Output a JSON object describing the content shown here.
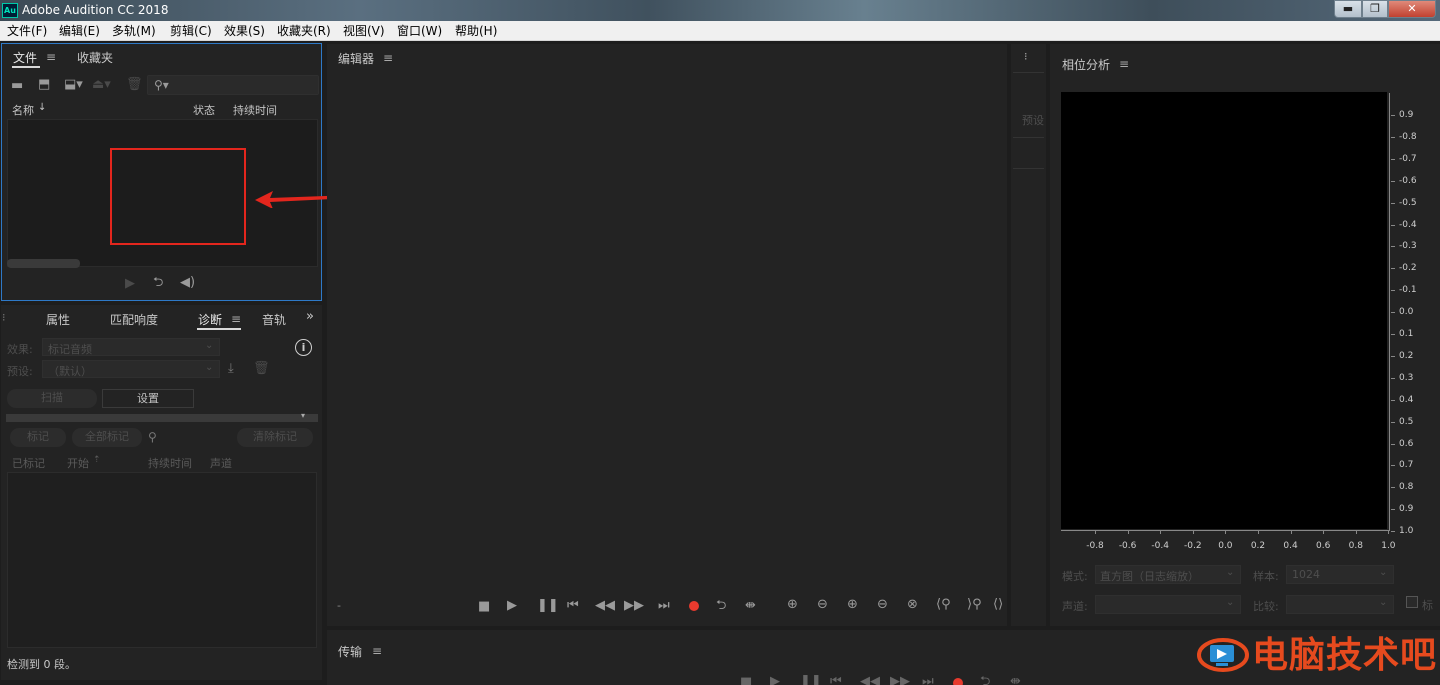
{
  "window": {
    "title": "Adobe Audition CC 2018",
    "logo_text": "Au",
    "controls": {
      "minimize": "▬",
      "maximize": "❐",
      "close": "✕"
    }
  },
  "menu": [
    "文件(F)",
    "编辑(E)",
    "多轨(M)",
    "剪辑(C)",
    "效果(S)",
    "收藏夹(R)",
    "视图(V)",
    "窗口(W)",
    "帮助(H)"
  ],
  "files_panel": {
    "tabs": [
      "文件",
      "收藏夹"
    ],
    "columns": {
      "name": "名称",
      "status": "状态",
      "duration": "持续时间"
    },
    "sort_arrow": "↓"
  },
  "diagnostics_panel": {
    "tabs": [
      "属性",
      "匹配响度",
      "诊断",
      "音轨"
    ],
    "effect_label": "效果:",
    "effect_value": "标记音频",
    "preset_label": "预设:",
    "preset_value": "（默认）",
    "scan_button": "扫描",
    "settings_button": "设置",
    "mark_button": "标记",
    "mark_all_button": "全部标记",
    "clear_marks_button": "清除标记",
    "columns": {
      "marked": "已标记",
      "start": "开始",
      "duration": "持续时间",
      "channel": "声道"
    },
    "status": "检测到 0 段。"
  },
  "editor": {
    "title": "编辑器",
    "time_text": "-"
  },
  "presets_strip": {
    "label": "预设"
  },
  "phase_analysis": {
    "title": "相位分析",
    "y_labels": [
      "0.9",
      "-0.8",
      "-0.7",
      "-0.6",
      "-0.5",
      "-0.4",
      "-0.3",
      "-0.2",
      "-0.1",
      "0.0",
      "0.1",
      "0.2",
      "0.3",
      "0.4",
      "0.5",
      "0.6",
      "0.7",
      "0.8",
      "0.9",
      "1.0"
    ],
    "x_labels": [
      "-0.8",
      "-0.6",
      "-0.4",
      "-0.2",
      "0.0",
      "0.2",
      "0.4",
      "0.6",
      "0.8",
      "1.0"
    ],
    "mode_label": "模式:",
    "mode_value": "直方图（日志缩放）",
    "sample_label": "样本:",
    "sample_value": "1024",
    "channel_label": "声道:",
    "compare_label": "比较:",
    "checkbox_label": "标"
  },
  "transport": {
    "title": "传输"
  },
  "watermark": {
    "text": "电脑技术吧"
  },
  "colors": {
    "accent_blue": "#2e79c7",
    "record_red": "#e83a2e",
    "annotation_red": "#e3261d",
    "watermark_orange": "#e64a1e"
  }
}
